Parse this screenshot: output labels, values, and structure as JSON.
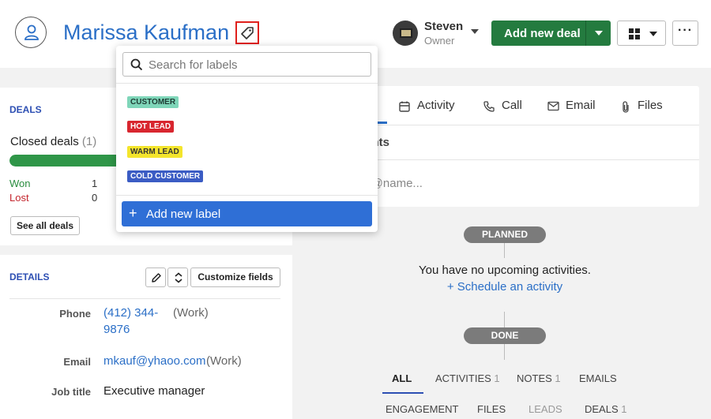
{
  "person": {
    "name": "Marissa Kaufman"
  },
  "owner": {
    "name": "Steven",
    "role": "Owner"
  },
  "header": {
    "add_deal_label": "Add new deal",
    "more_label": "···"
  },
  "label_dropdown": {
    "search_placeholder": "Search for labels",
    "labels": [
      {
        "text": "CUSTOMER",
        "bg": "#7fd6b9",
        "fg": "#1d3b33"
      },
      {
        "text": "HOT LEAD",
        "bg": "#d8262f",
        "fg": "#ffffff"
      },
      {
        "text": "WARM LEAD",
        "bg": "#f4e52c",
        "fg": "#333333"
      },
      {
        "text": "COLD CUSTOMER",
        "bg": "#3b5cc4",
        "fg": "#ffffff"
      }
    ],
    "add_label": "Add new label"
  },
  "deals": {
    "title": "DEALS",
    "closed_label": "Closed deals",
    "closed_count": "(1)",
    "won_fraction": 1.0,
    "won_label": "Won",
    "won_count": "1",
    "lost_label": "Lost",
    "lost_count": "0",
    "see_all": "See all deals"
  },
  "details": {
    "title": "DETAILS",
    "customize": "Customize fields",
    "phone_label": "Phone",
    "phone_line1": "(412) 344-",
    "phone_line2": "9876",
    "phone_type": "(Work)",
    "email_label": "Email",
    "email_value": "mkauf@yhaoo.com",
    "email_type": "(Work)",
    "job_label": "Job title",
    "job_value": "Executive manager"
  },
  "composer": {
    "tabs": [
      "Activity",
      "Call",
      "Email",
      "Files"
    ],
    "notes_tab": "nents",
    "placeholder": "e, @name..."
  },
  "activities": {
    "planned": "PLANNED",
    "empty": "You have no upcoming activities.",
    "schedule": "+ Schedule an activity",
    "done": "DONE"
  },
  "history": {
    "row1": [
      {
        "label": "ALL",
        "count": ""
      },
      {
        "label": "ACTIVITIES",
        "count": "1"
      },
      {
        "label": "NOTES",
        "count": "1"
      },
      {
        "label": "EMAILS",
        "count": ""
      }
    ],
    "row2": [
      {
        "label": "ENGAGEMENT",
        "count": ""
      },
      {
        "label": "FILES",
        "count": ""
      },
      {
        "label": "LEADS",
        "count": ""
      },
      {
        "label": "DEALS",
        "count": "1"
      }
    ]
  },
  "colors": {
    "accent": "#2b6fc7",
    "green": "#247b3f",
    "section_title": "#2d4fb3"
  }
}
